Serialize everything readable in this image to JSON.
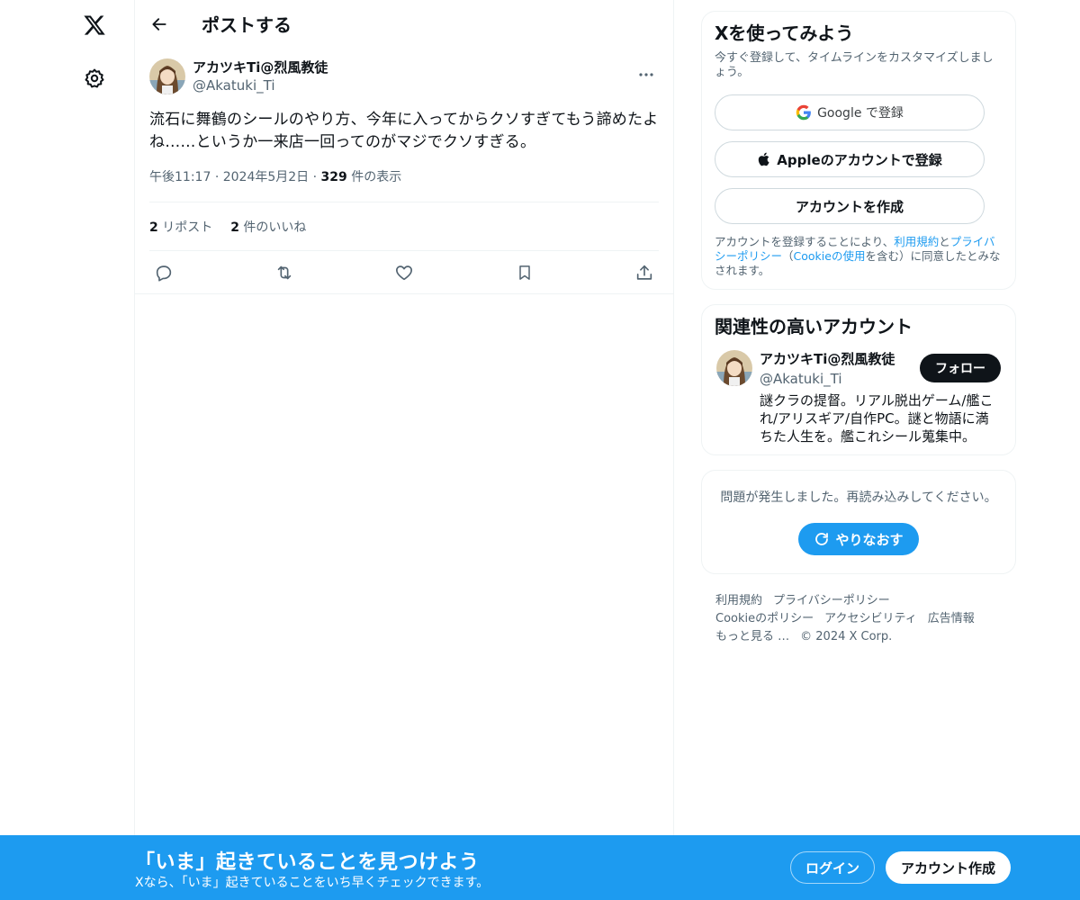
{
  "nav": {
    "logo_icon": "x-logo-icon",
    "settings_icon": "gear-icon"
  },
  "header": {
    "title": "ポストする"
  },
  "post": {
    "display_name": "アカツキTi@烈風教徒",
    "handle": "@Akatuki_Ti",
    "text": "流石に舞鶴のシールのやり方、今年に入ってからクソすぎてもう諦めたよね……というか一来店一回ってのがマジでクソすぎる。",
    "time": "午後11:17",
    "date": "2024年5月2日",
    "views_count": "329",
    "views_label": " 件の表示",
    "reposts_count": "2",
    "reposts_label": "リポスト",
    "likes_count": "2",
    "likes_label": "件のいいね"
  },
  "signup": {
    "title": "Xを使ってみよう",
    "subtitle": "今すぐ登録して、タイムラインをカスタマイズしましょう。",
    "google_label": "Google で登録",
    "apple_label": "Appleのアカウントで登録",
    "create_label": "アカウントを作成",
    "terms_pre": "アカウントを登録することにより、",
    "terms_link": "利用規約",
    "terms_and": "と",
    "privacy_link": "プライバシーポリシー",
    "cookie_pre": "（",
    "cookie_link": "Cookieの使用",
    "cookie_post": "を含む）に同意したとみなされます。"
  },
  "related": {
    "title": "関連性の高いアカウント",
    "name": "アカツキTi@烈風教徒",
    "handle": "@Akatuki_Ti",
    "bio": "謎クラの提督。リアル脱出ゲーム/艦これ/アリスギア/自作PC。謎と物語に満ちた人生を。艦これシール蒐集中。",
    "follow_label": "フォロー"
  },
  "error": {
    "message": "問題が発生しました。再読み込みしてください。",
    "retry_label": "やりなおす"
  },
  "footer": {
    "links": [
      "利用規約",
      "プライバシーポリシー",
      "Cookieのポリシー",
      "アクセシビリティ",
      "広告情報",
      "もっと見る …",
      "© 2024 X Corp."
    ]
  },
  "banner": {
    "title": "「いま」起きていることを見つけよう",
    "subtitle": "Xなら、「いま」起きていることをいち早くチェックできます。",
    "login_label": "ログイン",
    "create_label": "アカウント作成"
  },
  "colors": {
    "accent": "#1d9bf0",
    "text": "#0f1419",
    "muted": "#536471",
    "border": "#eff3f4"
  }
}
